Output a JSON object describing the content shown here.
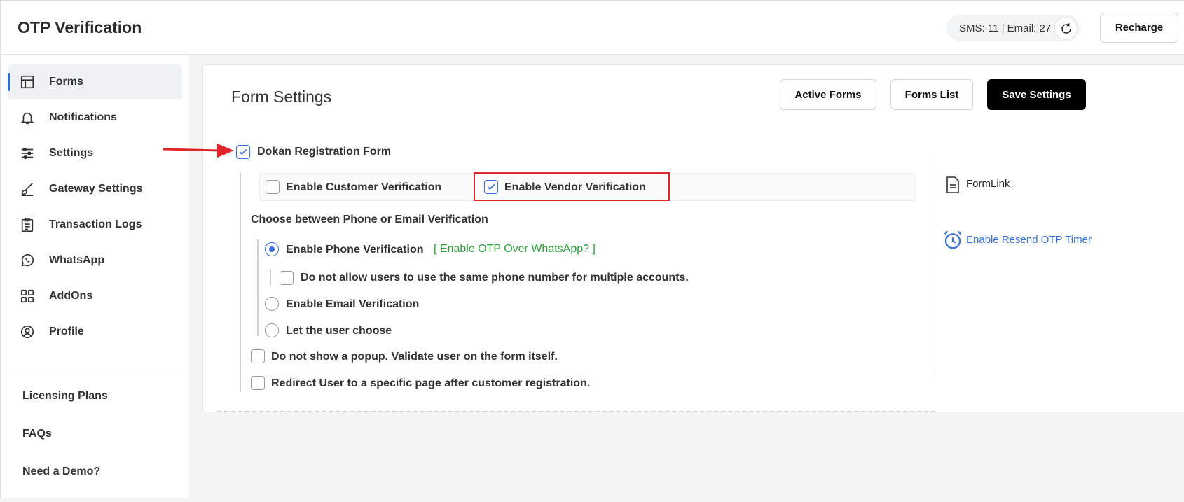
{
  "header": {
    "title": "OTP Verification",
    "counter": "SMS: 11 | Email: 27",
    "recharge_label": "Recharge"
  },
  "sidebar": {
    "items": [
      {
        "label": "Forms",
        "icon": "layout-icon"
      },
      {
        "label": "Notifications",
        "icon": "bell-icon"
      },
      {
        "label": "Settings",
        "icon": "sliders-icon"
      },
      {
        "label": "Gateway Settings",
        "icon": "brush-icon"
      },
      {
        "label": "Transaction Logs",
        "icon": "clipboard-icon"
      },
      {
        "label": "WhatsApp",
        "icon": "whatsapp-icon"
      },
      {
        "label": "AddOns",
        "icon": "grid-icon"
      },
      {
        "label": "Profile",
        "icon": "user-circle-icon"
      }
    ],
    "links": [
      "Licensing Plans",
      "FAQs",
      "Need a Demo?"
    ]
  },
  "main": {
    "title": "Form Settings",
    "buttons": {
      "active_forms": "Active Forms",
      "forms_list": "Forms List",
      "save_settings": "Save Settings"
    },
    "form_name": "Dokan Registration Form",
    "enable_customer": "Enable Customer Verification",
    "enable_vendor": "Enable Vendor Verification",
    "choose_label": "Choose between Phone or Email Verification",
    "phone_verification": "Enable Phone Verification",
    "whatsapp_option": "[ Enable OTP Over WhatsApp? ]",
    "same_phone": "Do not allow users to use the same phone number for multiple accounts.",
    "email_verification": "Enable Email Verification",
    "user_choose": "Let the user choose",
    "no_popup": "Do not show a popup. Validate user on the form itself.",
    "redirect": "Redirect User to a specific page after customer registration.",
    "formlink": "FormLink",
    "resend_timer": "Enable Resend OTP Timer"
  },
  "colors": {
    "accent": "#3b6fd9",
    "highlight_box": "#e0242b",
    "whatsapp_green": "#2e9e3f"
  }
}
